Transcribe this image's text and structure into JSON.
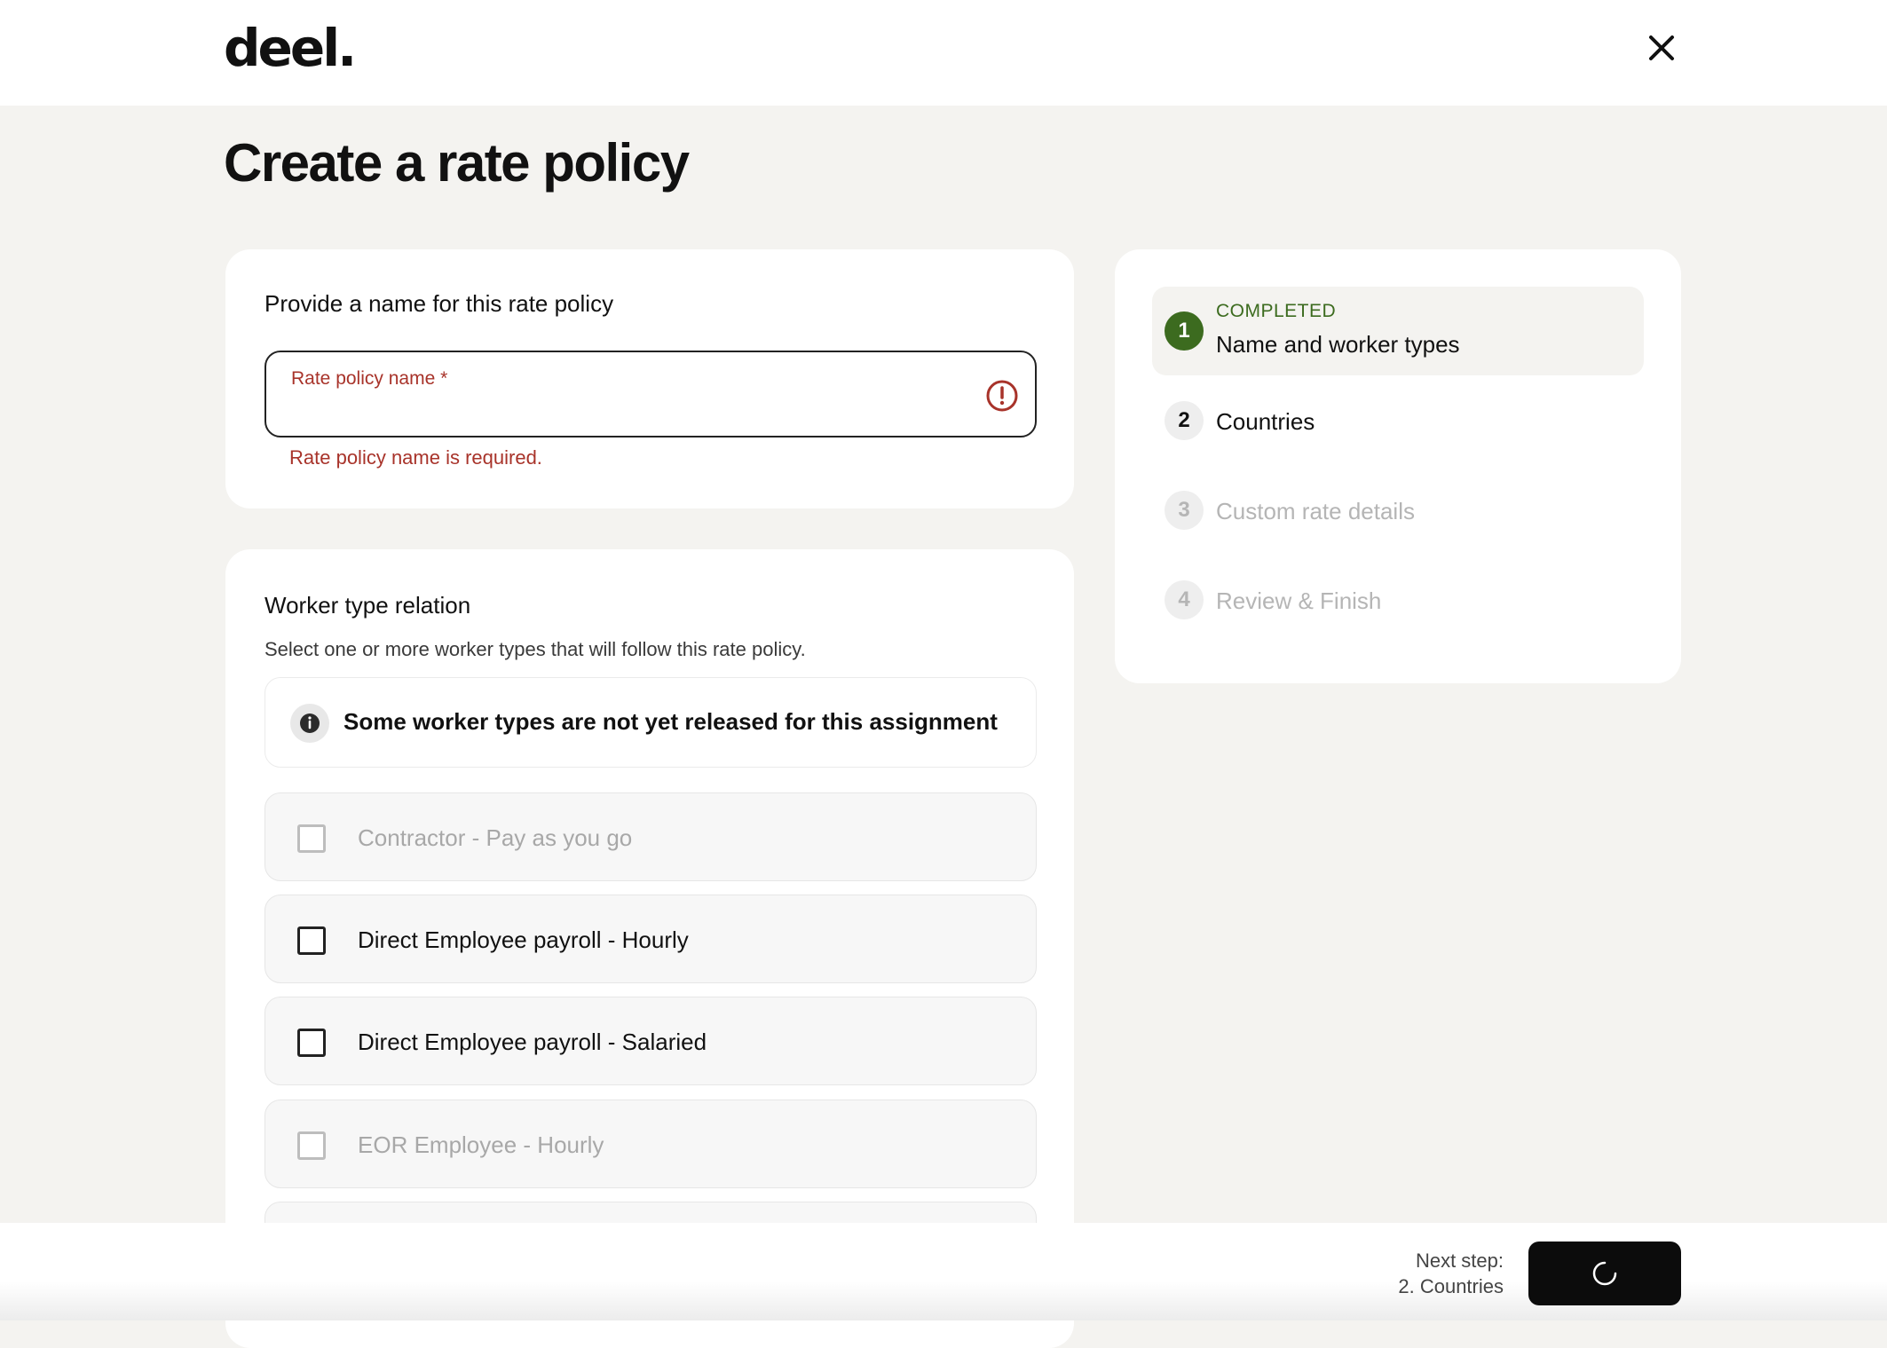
{
  "header": {
    "logo_text": "deel."
  },
  "page": {
    "title": "Create a rate policy"
  },
  "name_section": {
    "title": "Provide a name for this rate policy",
    "input_label": "Rate policy name *",
    "input_value": "",
    "error_message": "Rate policy name is required."
  },
  "worker_section": {
    "title": "Worker type relation",
    "subtitle": "Select one or more worker types that will follow this rate policy.",
    "info_message": "Some worker types are not yet released for this assignment",
    "options": [
      {
        "label": "Contractor - Pay as you go",
        "disabled": true,
        "checked": false
      },
      {
        "label": "Direct Employee payroll - Hourly",
        "disabled": false,
        "checked": false
      },
      {
        "label": "Direct Employee payroll - Salaried",
        "disabled": false,
        "checked": false
      },
      {
        "label": "EOR Employee - Hourly",
        "disabled": true,
        "checked": false
      }
    ]
  },
  "steps": [
    {
      "number": "1",
      "status": "COMPLETED",
      "label": "Name and worker types"
    },
    {
      "number": "2",
      "label": "Countries"
    },
    {
      "number": "3",
      "label": "Custom rate details"
    },
    {
      "number": "4",
      "label": "Review & Finish"
    }
  ],
  "footer": {
    "next_step_label": "Next step:",
    "next_step_value": "2. Countries"
  },
  "colors": {
    "error": "#a8332a",
    "completed": "#3c6b1f",
    "primary_button": "#0c0c0c",
    "background": "#f4f3f0"
  }
}
